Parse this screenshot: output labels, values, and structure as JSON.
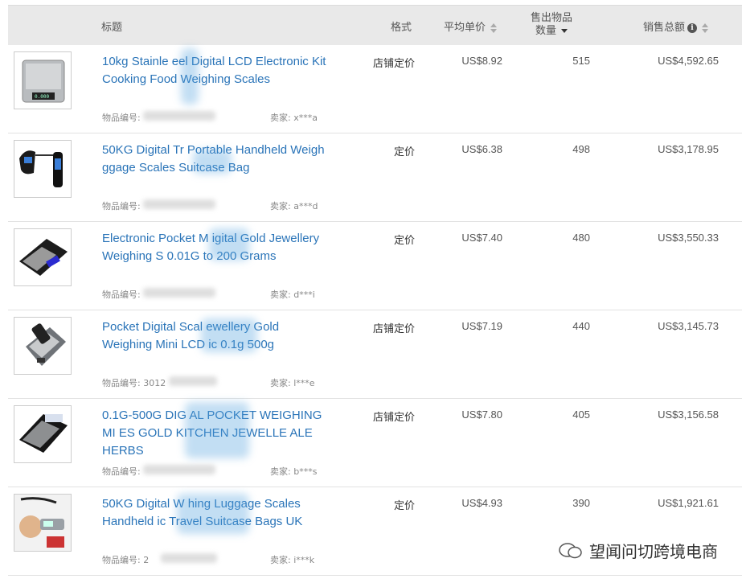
{
  "header": {
    "title": "标题",
    "format": "格式",
    "avg_price": "平均单价",
    "sold_line1": "售出物品",
    "sold_line2": "数量",
    "total": "销售总额"
  },
  "labels": {
    "item_no": "物品编号:",
    "seller": "卖家:"
  },
  "rows": [
    {
      "title": "10kg Stainle  eel Digital LCD Electronic Kit   Cooking Food Weighing Scales",
      "item_no": "",
      "seller": "x***a",
      "format": "店铺定价",
      "avg": "US$8.92",
      "sold": "515",
      "total": "US$4,592.65",
      "image": "kitchen-scale-image"
    },
    {
      "title": "50KG Digital Tr   Portable Handheld Weigh    ggage Scales Suitcase Bag",
      "item_no": "",
      "seller": "a***d",
      "format": "定价",
      "avg": "US$6.38",
      "sold": "498",
      "total": "US$3,178.95",
      "image": "luggage-scale-image"
    },
    {
      "title": "Electronic Pocket M  igital Gold Jewellery Weighing S   0.01G to 200 Grams",
      "item_no": "",
      "seller": "d***i",
      "format": "定价",
      "avg": "US$7.40",
      "sold": "480",
      "total": "US$3,550.33",
      "image": "pocket-scale-image"
    },
    {
      "title": "Pocket Digital Scal   ewellery Gold Weighing Mini LCD     ic 0.1g 500g",
      "item_no": "3012",
      "seller": "l***e",
      "format": "店铺定价",
      "avg": "US$7.19",
      "sold": "440",
      "total": "US$3,145.73",
      "image": "mini-scale-image"
    },
    {
      "title": "0.1G-500G DIG  AL POCKET WEIGHING MI    ES GOLD KITCHEN JEWELLE    ALE HERBS",
      "item_no": "",
      "seller": "b***s",
      "format": "店铺定价",
      "avg": "US$7.80",
      "sold": "405",
      "total": "US$3,156.58",
      "image": "digital-pocket-scale-image"
    },
    {
      "title": "50KG Digital W   hing Luggage Scales Handheld    ic Travel Suitcase Bags UK",
      "item_no": "2",
      "seller": "i***k",
      "format": "定价",
      "avg": "US$4.93",
      "sold": "390",
      "total": "US$1,921.61",
      "image": "travel-scale-image"
    }
  ],
  "watermark": "望闻问切跨境电商",
  "colors": {
    "link": "#2a74b8",
    "header_bg": "#e9e9e9"
  }
}
